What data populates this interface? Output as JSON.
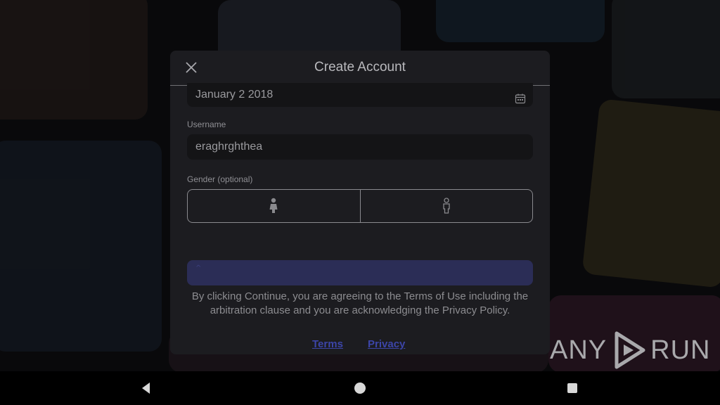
{
  "modal": {
    "title": "Create Account",
    "birthday_value": "January 2 2018",
    "username_label": "Username",
    "username_value": "eraghrghthea",
    "gender_label": "Gender (optional)",
    "gender_options": [
      "female",
      "male"
    ],
    "continue_label": "^",
    "legal_text": "By clicking Continue, you are agreeing to the Terms of Use including the arbitration clause and you are acknowledging the Privacy Policy.",
    "terms_link": "Terms",
    "privacy_link": "Privacy"
  },
  "watermark": {
    "text_left": "ANY",
    "text_right": "RUN"
  },
  "navbar": {
    "buttons": [
      "back",
      "home",
      "recents"
    ]
  },
  "colors": {
    "modal_bg": "#1c1c20",
    "continue_bg": "#2b2d56",
    "link": "#3c45a8"
  }
}
